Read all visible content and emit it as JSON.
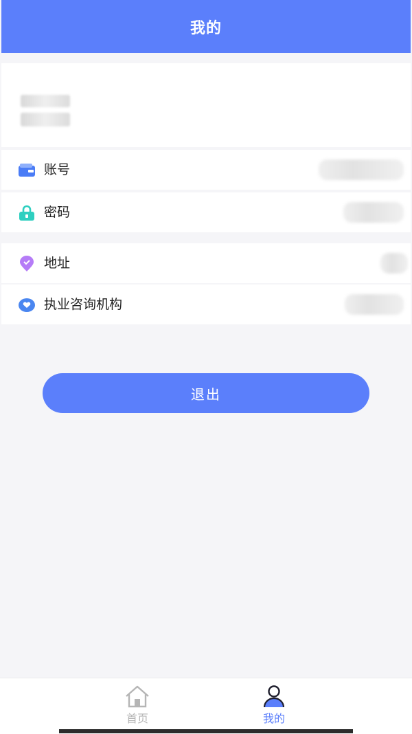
{
  "header": {
    "title": "我的"
  },
  "menu": {
    "account": {
      "label": "账号",
      "icon": "wallet-card-icon",
      "color": "#4a7cf6"
    },
    "password": {
      "label": "密码",
      "icon": "lock-icon",
      "color": "#2fcfc0"
    },
    "address": {
      "label": "地址",
      "icon": "location-pin-icon",
      "color": "#b57cf7"
    },
    "institution": {
      "label": "执业咨询机构",
      "icon": "heart-badge-icon",
      "color": "#4a86f0"
    }
  },
  "logout": {
    "label": "退出"
  },
  "tabbar": {
    "home": {
      "label": "首页",
      "icon": "home-icon",
      "active": false
    },
    "mine": {
      "label": "我的",
      "icon": "user-icon",
      "active": true
    }
  },
  "colors": {
    "primary": "#5b7ffb",
    "background": "#f5f5f8",
    "tab_inactive": "#b5b5b5"
  }
}
